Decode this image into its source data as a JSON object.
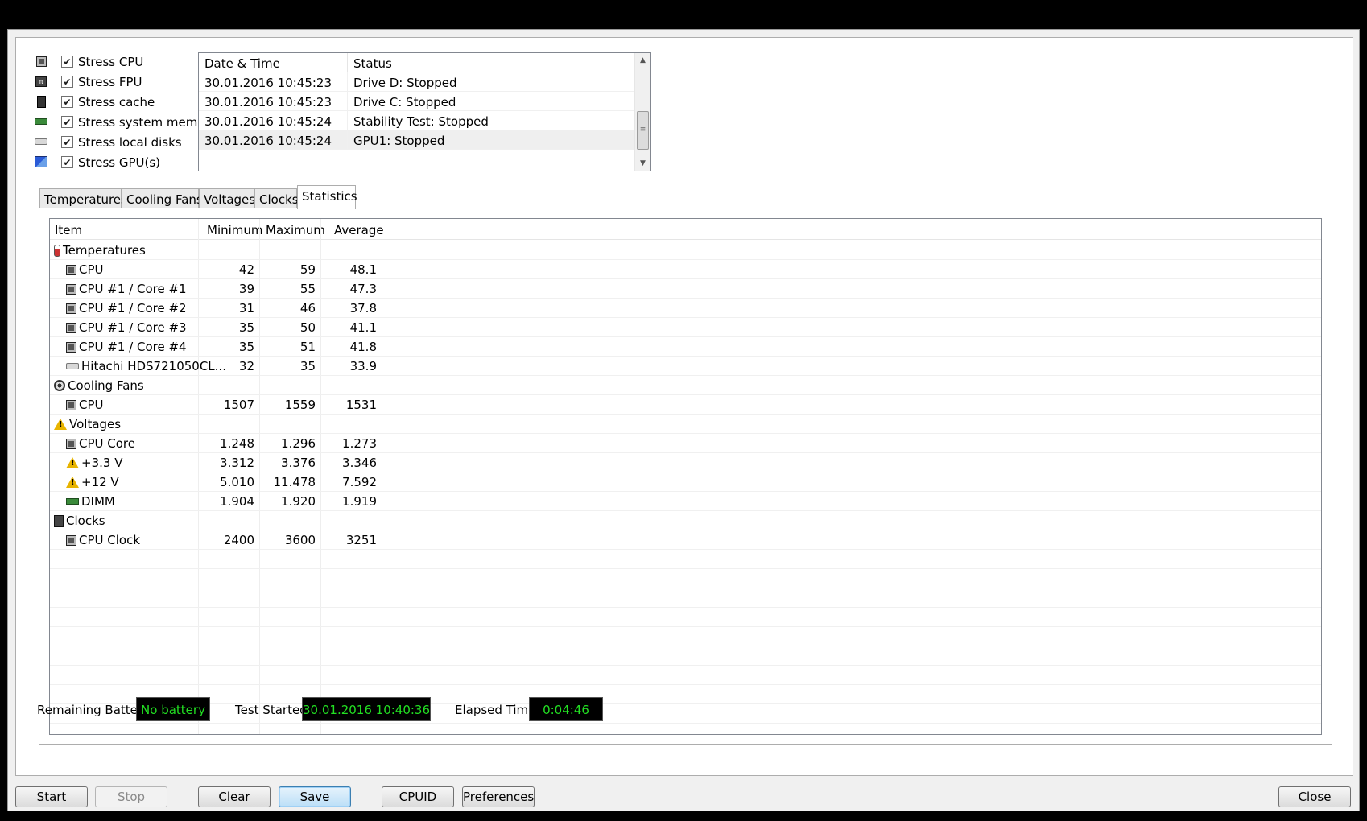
{
  "stress_options": [
    {
      "icon": "cpu-chip-icon",
      "label": "Stress CPU",
      "checked": true
    },
    {
      "icon": "fpu-chip-icon",
      "label": "Stress FPU",
      "checked": true
    },
    {
      "icon": "cache-chip-icon",
      "label": "Stress cache",
      "checked": true
    },
    {
      "icon": "memory-module-icon",
      "label": "Stress system memory",
      "checked": true
    },
    {
      "icon": "hard-disk-icon",
      "label": "Stress local disks",
      "checked": true
    },
    {
      "icon": "gpu-icon",
      "label": "Stress GPU(s)",
      "checked": true
    }
  ],
  "log": {
    "headers": {
      "date_time": "Date & Time",
      "status": "Status"
    },
    "rows": [
      {
        "date_time": "30.01.2016 10:45:23",
        "status": "Drive D: Stopped"
      },
      {
        "date_time": "30.01.2016 10:45:23",
        "status": "Drive C: Stopped"
      },
      {
        "date_time": "30.01.2016 10:45:24",
        "status": "Stability Test: Stopped"
      },
      {
        "date_time": "30.01.2016 10:45:24",
        "status": "GPU1: Stopped"
      }
    ]
  },
  "tabs": [
    "Temperatures",
    "Cooling Fans",
    "Voltages",
    "Clocks",
    "Statistics"
  ],
  "active_tab": "Statistics",
  "stats": {
    "headers": {
      "item": "Item",
      "minimum": "Minimum",
      "maximum": "Maximum",
      "average": "Average"
    },
    "rows": [
      {
        "kind": "group",
        "icon": "thermometer-icon",
        "name": "Temperatures"
      },
      {
        "kind": "item",
        "icon": "cpu-chip-icon",
        "name": "CPU",
        "min": "42",
        "max": "59",
        "avg": "48.1"
      },
      {
        "kind": "item",
        "icon": "cpu-chip-icon",
        "name": "CPU #1 / Core #1",
        "min": "39",
        "max": "55",
        "avg": "47.3"
      },
      {
        "kind": "item",
        "icon": "cpu-chip-icon",
        "name": "CPU #1 / Core #2",
        "min": "31",
        "max": "46",
        "avg": "37.8"
      },
      {
        "kind": "item",
        "icon": "cpu-chip-icon",
        "name": "CPU #1 / Core #3",
        "min": "35",
        "max": "50",
        "avg": "41.1"
      },
      {
        "kind": "item",
        "icon": "cpu-chip-icon",
        "name": "CPU #1 / Core #4",
        "min": "35",
        "max": "51",
        "avg": "41.8"
      },
      {
        "kind": "item",
        "icon": "hard-disk-icon",
        "name": "Hitachi HDS721050CL...",
        "min": "32",
        "max": "35",
        "avg": "33.9"
      },
      {
        "kind": "group",
        "icon": "fan-icon",
        "name": "Cooling Fans"
      },
      {
        "kind": "item",
        "icon": "cpu-chip-icon",
        "name": "CPU",
        "min": "1507",
        "max": "1559",
        "avg": "1531"
      },
      {
        "kind": "group",
        "icon": "warning-icon",
        "name": "Voltages"
      },
      {
        "kind": "item",
        "icon": "cpu-chip-icon",
        "name": "CPU Core",
        "min": "1.248",
        "max": "1.296",
        "avg": "1.273"
      },
      {
        "kind": "item",
        "icon": "warning-icon",
        "name": "+3.3 V",
        "min": "3.312",
        "max": "3.376",
        "avg": "3.346"
      },
      {
        "kind": "item",
        "icon": "warning-icon",
        "name": "+12 V",
        "min": "5.010",
        "max": "11.478",
        "avg": "7.592"
      },
      {
        "kind": "item",
        "icon": "memory-module-icon",
        "name": "DIMM",
        "min": "1.904",
        "max": "1.920",
        "avg": "1.919"
      },
      {
        "kind": "group",
        "icon": "clock-chip-icon",
        "name": "Clocks"
      },
      {
        "kind": "item",
        "icon": "cpu-chip-icon",
        "name": "CPU Clock",
        "min": "2400",
        "max": "3600",
        "avg": "3251"
      }
    ]
  },
  "status": {
    "battery_label": "Remaining Battery:",
    "battery_value": "No battery",
    "started_label": "Test Started:",
    "started_value": "30.01.2016 10:40:36",
    "elapsed_label": "Elapsed Time:",
    "elapsed_value": "0:04:46"
  },
  "buttons": {
    "start": "Start",
    "stop": "Stop",
    "clear": "Clear",
    "save": "Save",
    "cpuid": "CPUID",
    "preferences": "Preferences",
    "close": "Close"
  },
  "colors": {
    "status_text": "#22e022",
    "status_bg": "#000000"
  }
}
